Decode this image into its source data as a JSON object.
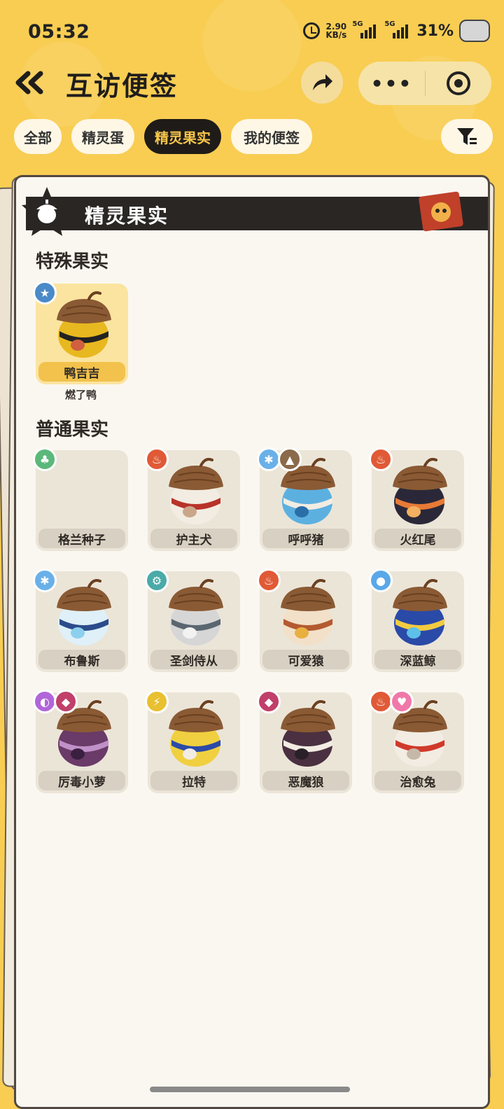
{
  "status": {
    "time": "05:32",
    "speed": "2.90",
    "speed_unit": "KB/s",
    "net1": "5G",
    "net2": "5G",
    "battery": "31%"
  },
  "header": {
    "title": "互访便签",
    "more_label": "•••"
  },
  "tabs": [
    {
      "label": "全部",
      "active": false
    },
    {
      "label": "精灵蛋",
      "active": false
    },
    {
      "label": "精灵果实",
      "active": true
    },
    {
      "label": "我的便签",
      "active": false
    }
  ],
  "card": {
    "banner_title": "精灵果实",
    "special_section": "特殊果实",
    "normal_section": "普通果实",
    "special": [
      {
        "name": "鸭吉吉",
        "subtitle": "燃了鸭",
        "elements": [
          "star"
        ],
        "colors": [
          "#e8b820",
          "#222",
          "#d06040"
        ]
      }
    ],
    "normal": [
      {
        "name": "格兰种子",
        "elements": [
          "grass"
        ],
        "colors": null
      },
      {
        "name": "护主犬",
        "elements": [
          "fire"
        ],
        "colors": [
          "#f2ece2",
          "#b8332a",
          "#c9a68a"
        ]
      },
      {
        "name": "呼呼猪",
        "elements": [
          "ice",
          "ground"
        ],
        "colors": [
          "#5cb0e0",
          "#f2ece2",
          "#2a6ea8"
        ]
      },
      {
        "name": "火红尾",
        "elements": [
          "fire"
        ],
        "colors": [
          "#2a2838",
          "#e87a36",
          "#f2b060"
        ]
      },
      {
        "name": "布鲁斯",
        "elements": [
          "ice"
        ],
        "colors": [
          "#dff0f8",
          "#2c4c8a",
          "#8cd0ee"
        ]
      },
      {
        "name": "圣剑侍从",
        "elements": [
          "mech"
        ],
        "colors": [
          "#d6d6d6",
          "#5a6670",
          "#f2f2f2"
        ]
      },
      {
        "name": "可爱猿",
        "elements": [
          "fire"
        ],
        "colors": [
          "#f2e0c8",
          "#b45a30",
          "#e8b040"
        ]
      },
      {
        "name": "深蓝鲸",
        "elements": [
          "water"
        ],
        "colors": [
          "#2a4aa8",
          "#f2cc40",
          "#5cc0e8"
        ]
      },
      {
        "name": "厉毒小萝",
        "elements": [
          "poison",
          "demon"
        ],
        "colors": [
          "#6a3a68",
          "#c090c8",
          "#3a2040"
        ]
      },
      {
        "name": "拉特",
        "elements": [
          "electric"
        ],
        "colors": [
          "#f0d040",
          "#2a4aa8",
          "#f2ece2"
        ]
      },
      {
        "name": "恶魔狼",
        "elements": [
          "demon"
        ],
        "colors": [
          "#4a3040",
          "#f2ece2",
          "#2a2028"
        ]
      },
      {
        "name": "治愈兔",
        "elements": [
          "fire",
          "heal"
        ],
        "colors": [
          "#f2ece2",
          "#d03a2a",
          "#c6b8a8"
        ]
      }
    ]
  },
  "icon_names": {
    "star": "star-badge-icon",
    "grass": "leaf-icon",
    "fire": "fire-icon",
    "ice": "snowflake-icon",
    "ground": "mountain-icon",
    "mech": "gear-icon",
    "water": "water-drop-icon",
    "poison": "poison-icon",
    "demon": "demon-icon",
    "electric": "lightning-icon",
    "heal": "heart-icon"
  },
  "element_colors": {
    "star": "#4a8ac8",
    "grass": "#5cb87a",
    "fire": "#e05a36",
    "ice": "#6ab0e8",
    "ground": "#8a6a4a",
    "mech": "#4aaaa8",
    "water": "#5aa8e8",
    "poison": "#b066d8",
    "demon": "#c0406a",
    "electric": "#e8c030",
    "heal": "#f078a8"
  }
}
